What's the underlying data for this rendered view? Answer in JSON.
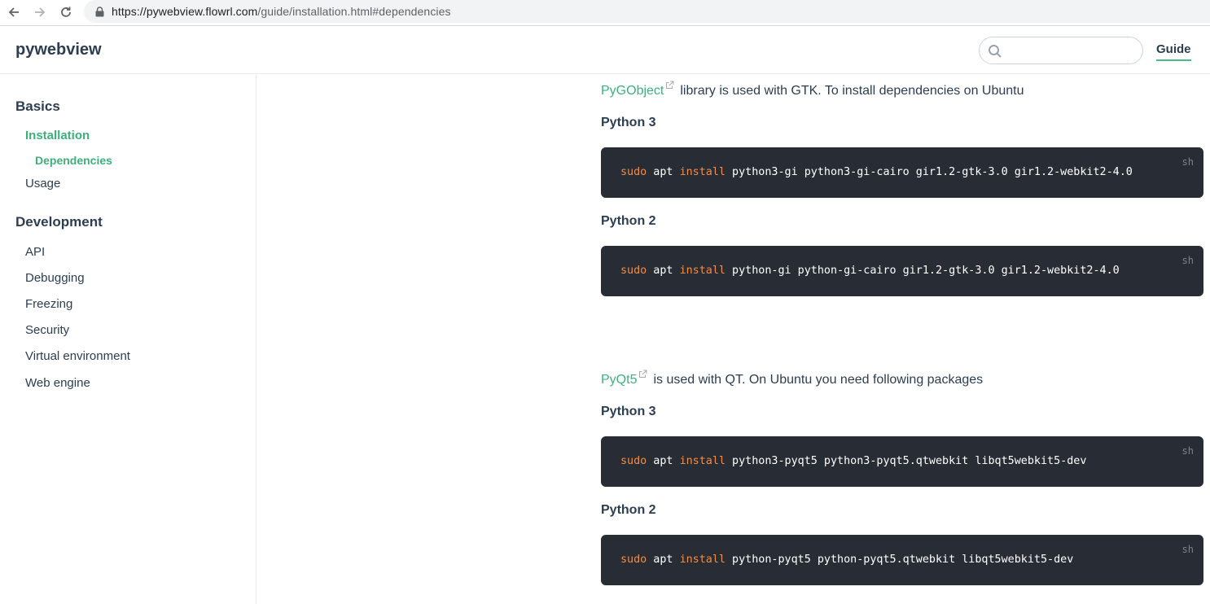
{
  "browser": {
    "url_host": "https://pywebview.flowrl.com",
    "url_path": "/guide/installation.html#dependencies"
  },
  "header": {
    "site_title": "pywebview",
    "search_placeholder": "",
    "nav_guide": "Guide"
  },
  "sidebar": {
    "groups": [
      {
        "title": "Basics",
        "items": [
          {
            "label": "Installation",
            "active": true,
            "sub": [
              {
                "label": "Dependencies"
              }
            ]
          },
          {
            "label": "Usage"
          }
        ]
      },
      {
        "title": "Development",
        "items": [
          {
            "label": "API"
          },
          {
            "label": "Debugging"
          },
          {
            "label": "Freezing"
          },
          {
            "label": "Security"
          },
          {
            "label": "Virtual environment"
          },
          {
            "label": "Web engine"
          }
        ]
      }
    ]
  },
  "content": {
    "gtk": {
      "link": "PyGObject",
      "text": "library is used with GTK. To install dependencies on Ubuntu",
      "py3_heading": "Python 3",
      "py3_code": {
        "sudo": "sudo",
        "apt": " apt ",
        "install": "install",
        "rest": " python3-gi python3-gi-cairo gir1.2-gtk-3.0 gir1.2-webkit2-4.0"
      },
      "py2_heading": "Python 2",
      "py2_code": {
        "sudo": "sudo",
        "apt": " apt ",
        "install": "install",
        "rest": " python-gi python-gi-cairo gir1.2-gtk-3.0 gir1.2-webkit2-4.0"
      }
    },
    "qt": {
      "link": "PyQt5",
      "text": "is used with QT. On Ubuntu you need following packages",
      "py3_heading": "Python 3",
      "py3_code": {
        "sudo": "sudo",
        "apt": " apt ",
        "install": "install",
        "rest": " python3-pyqt5 python3-pyqt5.qtwebkit libqt5webkit5-dev"
      },
      "py2_heading": "Python 2",
      "py2_code": {
        "sudo": "sudo",
        "apt": " apt ",
        "install": "install",
        "rest": " python-pyqt5 python-pyqt5.qtwebkit libqt5webkit5-dev"
      }
    },
    "code_lang": "sh"
  },
  "colors": {
    "accent": "#3eaf7c",
    "text": "#2c3e50",
    "code_bg": "#282c34",
    "code_cmd": "#f08d49"
  }
}
